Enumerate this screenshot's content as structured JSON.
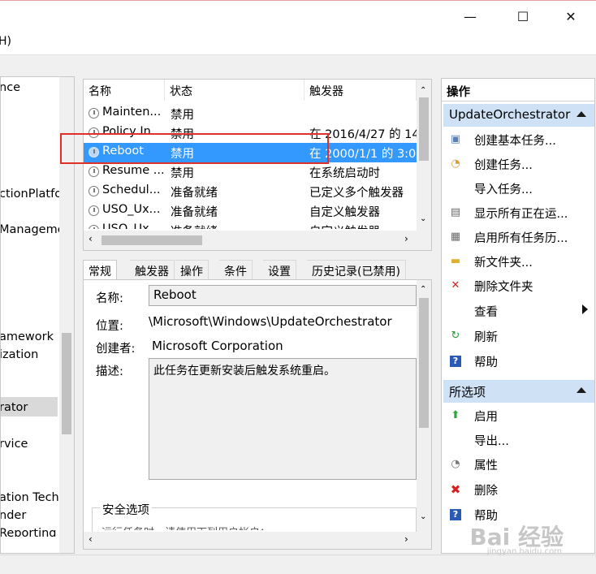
{
  "window": {
    "minimize": "—",
    "maximize": "☐",
    "close": "✕"
  },
  "menu": {
    "partial": "H)"
  },
  "left_tree": {
    "items": [
      "nce",
      "ctionPlatfo",
      "Manageme",
      "amework",
      "ization",
      "rator",
      "rvice",
      "ation Tech",
      "nder",
      "Reporting"
    ]
  },
  "task_list": {
    "columns": [
      "名称",
      "状态",
      "触发器"
    ],
    "rows": [
      {
        "name": "Mainten...",
        "status": "禁用",
        "trigger": ""
      },
      {
        "name": "Policy In...",
        "status": "禁用",
        "trigger": "在 2016/4/27 的 14"
      },
      {
        "name": "Reboot",
        "status": "禁用",
        "trigger": "在 2000/1/1 的 3:0"
      },
      {
        "name": "Resume ...",
        "status": "禁用",
        "trigger": "在系统启动时"
      },
      {
        "name": "Schedul...",
        "status": "准备就绪",
        "trigger": "已定义多个触发器"
      },
      {
        "name": "USO_Ux...",
        "status": "准备就绪",
        "trigger": "自定义触发器"
      },
      {
        "name": "USO_Ux...",
        "status": "准备就绪",
        "trigger": "自定义触发器"
      }
    ],
    "selected_index": 2
  },
  "detail": {
    "tabs": [
      "常规",
      "触发器",
      "操作",
      "条件",
      "设置",
      "历史记录(已禁用)"
    ],
    "name_label": "名称:",
    "name_value": "Reboot",
    "location_label": "位置:",
    "location_value": "\\Microsoft\\Windows\\UpdateOrchestrator",
    "author_label": "创建者:",
    "author_value": "Microsoft Corporation",
    "desc_label": "描述:",
    "desc_value": "此任务在更新安装后触发系统重启。",
    "security_label": "安全选项",
    "security_partial": "运行任务时，请使用下列用户帐户："
  },
  "actions": {
    "title": "操作",
    "section1": "UpdateOrchestrator",
    "items1": [
      {
        "label": "创建基本任务...",
        "icon": "wizard-icon"
      },
      {
        "label": "创建任务...",
        "icon": "create-task-icon"
      },
      {
        "label": "导入任务...",
        "icon": ""
      },
      {
        "label": "显示所有正在运...",
        "icon": "list-icon"
      },
      {
        "label": "启用所有任务历...",
        "icon": "history-icon"
      },
      {
        "label": "新文件夹...",
        "icon": "folder-icon"
      },
      {
        "label": "删除文件夹",
        "icon": "delete-icon"
      },
      {
        "label": "查看",
        "icon": ""
      },
      {
        "label": "刷新",
        "icon": "refresh-icon"
      },
      {
        "label": "帮助",
        "icon": "help-icon"
      }
    ],
    "section2": "所选项",
    "items2": [
      {
        "label": "启用",
        "icon": "enable-icon"
      },
      {
        "label": "导出...",
        "icon": ""
      },
      {
        "label": "属性",
        "icon": "properties-icon"
      },
      {
        "label": "删除",
        "icon": "delete-icon"
      },
      {
        "label": "帮助",
        "icon": "help-icon"
      }
    ]
  },
  "watermark": {
    "brand": "Bai 经验",
    "url": "jingyan.baidu.com"
  },
  "colors": {
    "selection": "#3399ff",
    "section_header": "#cfe2f5",
    "highlight_box": "#e0302a"
  }
}
